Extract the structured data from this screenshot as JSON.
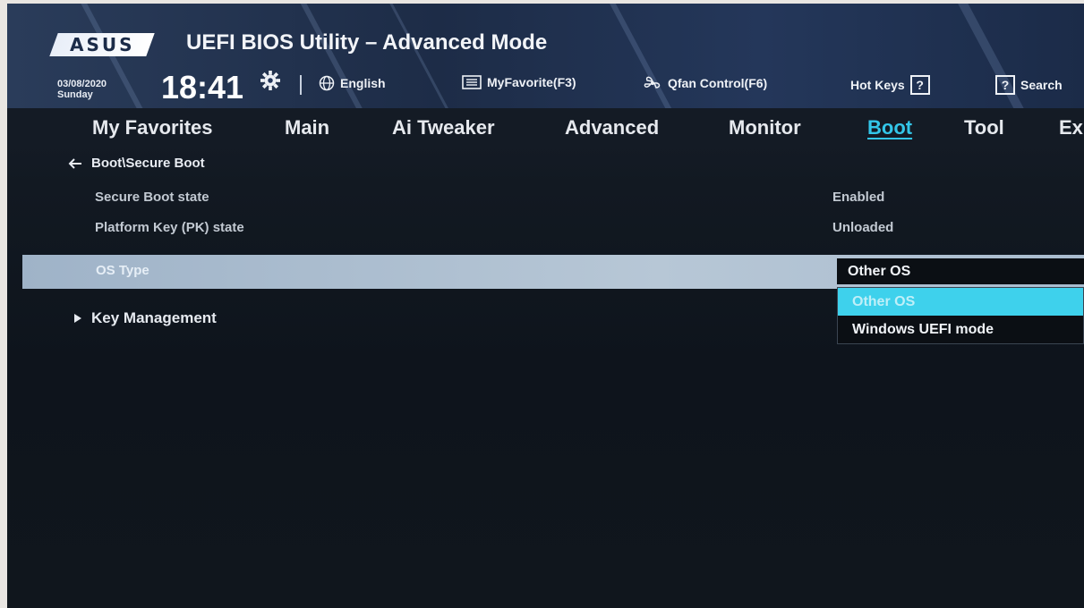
{
  "header": {
    "brand": "ASUS",
    "title": "UEFI BIOS Utility – Advanced Mode",
    "date": "03/08/2020",
    "day": "Sunday",
    "time": "18:41",
    "language": "English",
    "favorites": "MyFavorite(F3)",
    "qfan": "Qfan Control(F6)",
    "hotkeys": "Hot Keys",
    "hotkeys_icon_text": "?",
    "search": "Search",
    "search_icon_text": "?"
  },
  "nav": {
    "tabs": [
      {
        "label": "My Favorites"
      },
      {
        "label": "Main"
      },
      {
        "label": "Ai Tweaker"
      },
      {
        "label": "Advanced"
      },
      {
        "label": "Monitor"
      },
      {
        "label": "Boot"
      },
      {
        "label": "Tool"
      },
      {
        "label": "Ex"
      }
    ],
    "active": "Boot"
  },
  "content": {
    "breadcrumb": "Boot\\Secure Boot",
    "rows": [
      {
        "label": "Secure Boot state",
        "value": "Enabled"
      },
      {
        "label": "Platform Key (PK) state",
        "value": "Unloaded"
      }
    ],
    "os_type": {
      "label": "OS Type",
      "selected": "Other OS",
      "options": [
        "Other OS",
        "Windows UEFI mode"
      ]
    },
    "submenu": "Key Management"
  },
  "colors": {
    "accent": "#33c6e9",
    "highlight_row": "#b7c7d6",
    "background": "#121922"
  }
}
